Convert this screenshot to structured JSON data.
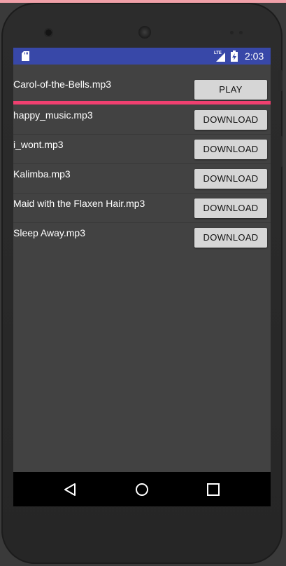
{
  "status_bar": {
    "time": "2:03",
    "network": "LTE",
    "icons": [
      "sd-card-icon",
      "lte-signal-icon",
      "battery-charging-icon"
    ]
  },
  "songs": [
    {
      "name": "Carol-of-the-Bells.mp3",
      "action": "PLAY"
    },
    {
      "name": "happy_music.mp3",
      "action": "DOWNLOAD"
    },
    {
      "name": "i_wont.mp3",
      "action": "DOWNLOAD"
    },
    {
      "name": "Kalimba.mp3",
      "action": "DOWNLOAD"
    },
    {
      "name": "Maid with the Flaxen Hair.mp3",
      "action": "DOWNLOAD"
    },
    {
      "name": "Sleep Away.mp3",
      "action": "DOWNLOAD"
    }
  ],
  "playback_progress": 1.0,
  "nav_bar": {
    "icons": [
      "back-icon",
      "home-icon",
      "recents-icon"
    ]
  },
  "colors": {
    "status_bar": "#3848a8",
    "accent": "#f04070",
    "background": "#424242",
    "button": "#d6d6d6"
  }
}
